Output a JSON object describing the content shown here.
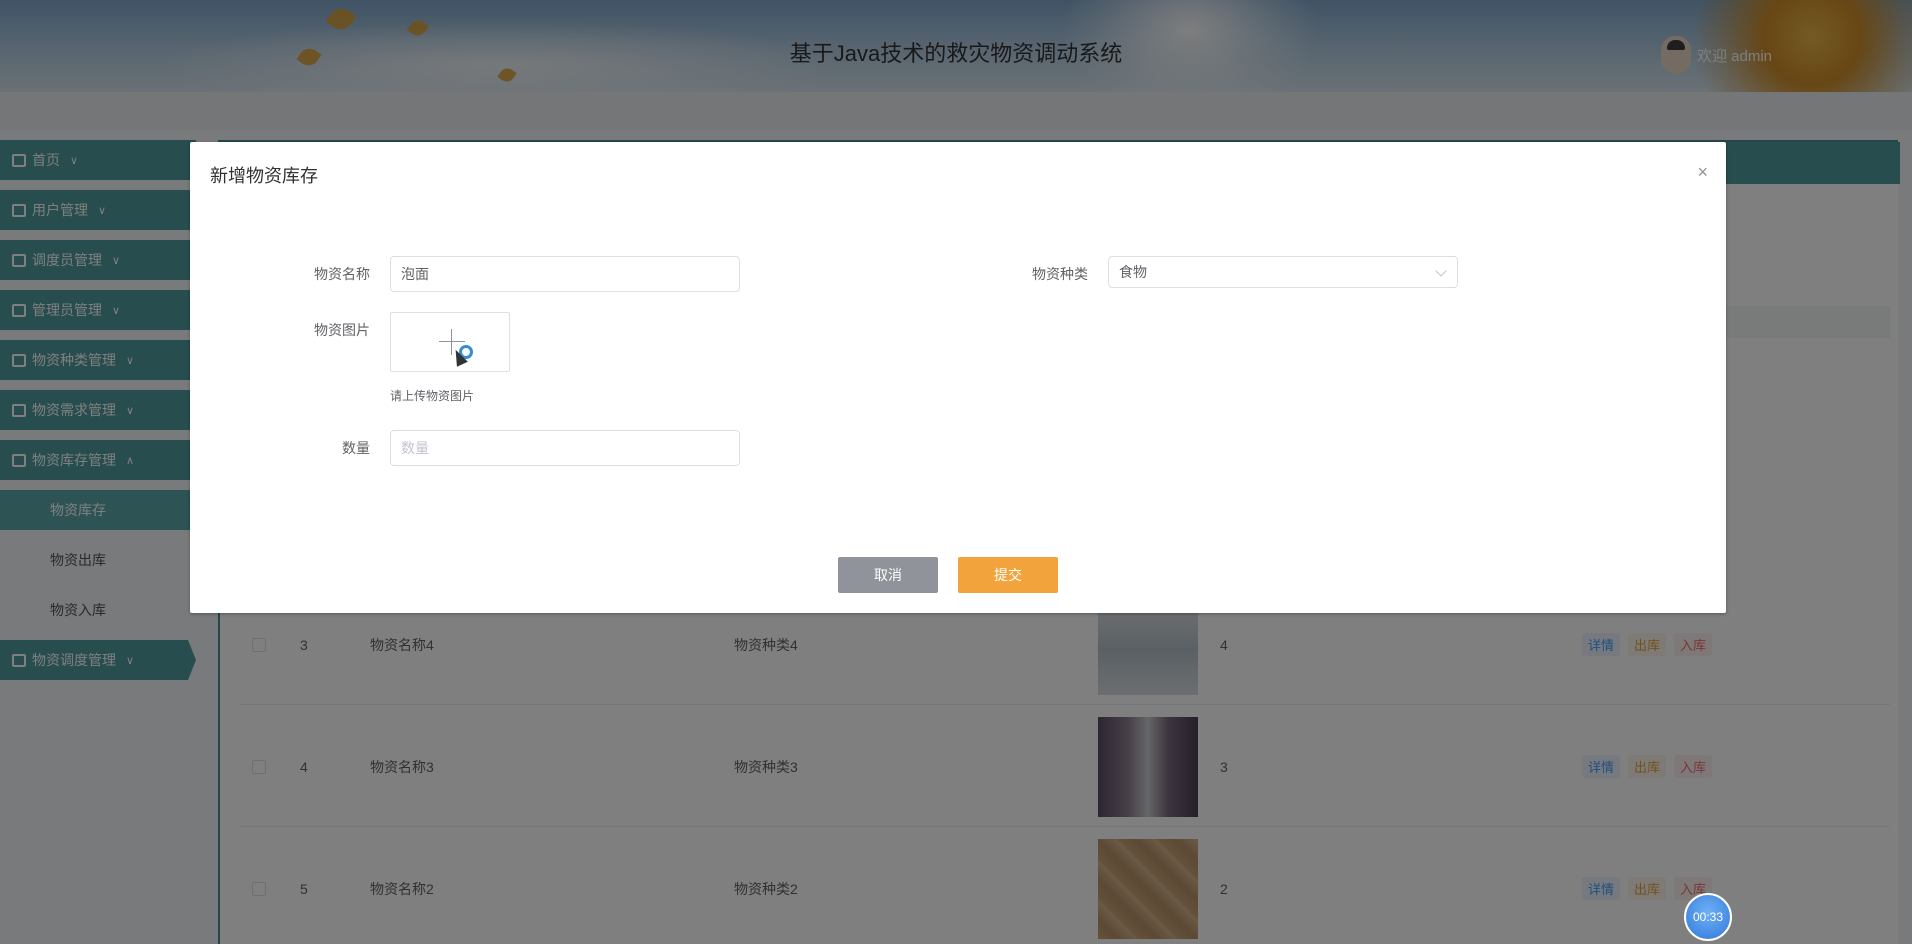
{
  "header": {
    "title": "基于Java技术的救灾物资调动系统",
    "user": "欢迎 admin"
  },
  "sidebar": {
    "items": [
      {
        "label": "首页"
      },
      {
        "label": "用户管理"
      },
      {
        "label": "调度员管理"
      },
      {
        "label": "管理员管理"
      },
      {
        "label": "物资种类管理"
      },
      {
        "label": "物资需求管理"
      },
      {
        "label": "物资库存管理"
      }
    ],
    "sub_items": [
      {
        "label": "物资库存"
      },
      {
        "label": "物资出库"
      },
      {
        "label": "物资入库"
      }
    ],
    "last_item": {
      "label": "物资调度管理"
    }
  },
  "table": {
    "rows": [
      {
        "index": "3",
        "name": "物资名称4",
        "category": "物资种类4",
        "qty": "4",
        "thumb_color": "#9aa9b3"
      },
      {
        "index": "4",
        "name": "物资名称3",
        "category": "物资种类3",
        "qty": "3",
        "thumb_color": "#6b5a73"
      },
      {
        "index": "5",
        "name": "物资名称2",
        "category": "物资种类2",
        "qty": "2",
        "thumb_color": "#b8936a"
      }
    ],
    "ops": {
      "detail": "详情",
      "out": "出库",
      "in": "入库"
    }
  },
  "dialog": {
    "title": "新增物资库存",
    "close": "×",
    "fields": {
      "name_label": "物资名称",
      "name_value": "泡面",
      "category_label": "物资种类",
      "category_value": "食物",
      "image_label": "物资图片",
      "image_tip": "请上传物资图片",
      "qty_label": "数量",
      "qty_placeholder": "数量"
    },
    "buttons": {
      "cancel": "取消",
      "submit": "提交"
    }
  },
  "timer": "00:33"
}
